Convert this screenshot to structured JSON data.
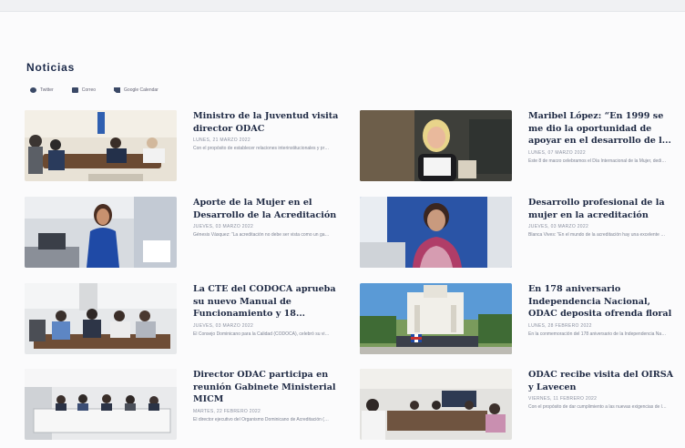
{
  "section": {
    "title": "Noticias"
  },
  "share": [
    {
      "label": "Twitter",
      "icon": "twitter-icon"
    },
    {
      "label": "Correo",
      "icon": "mail-icon"
    },
    {
      "label": "Google Calendar",
      "icon": "calendar-icon"
    }
  ],
  "news": [
    {
      "title": "Ministro de la Juventud visita director ODAC",
      "date": "LUNES, 21 MARZO 2022",
      "excerpt": "Con el propósito de establecer relaciones interinstitucionales y promover sinergias..."
    },
    {
      "title": "Maribel López: “En 1999 se me dio la oportunidad de apoyar en el desarrollo de l...",
      "date": "LUNES, 07 MARZO 2022",
      "excerpt": "Este 8 de marzo celebramos el Día Internacional de la Mujer, dedicado por la..."
    },
    {
      "title": "Aporte de la Mujer en el Desarrollo de la Acreditación",
      "date": "JUEVES, 03 MARZO 2022",
      "excerpt": "Génesis Vásquez: “La acreditación no debe ser vista como un gasto, sino como una..."
    },
    {
      "title": "Desarrollo profesional de la mujer en la acreditación",
      "date": "JUEVES, 03 MARZO 2022",
      "excerpt": "Blanca Vives: “En el mundo de la acreditación hay una excelente oportunidad para ei..."
    },
    {
      "title": "La CTE del CODOCA aprueba su nuevo Manual de Funcionamiento y 18...",
      "date": "JUEVES, 03 MARZO 2022",
      "excerpt": "El Consejo Dominicano para la Calidad (CODOCA), celebró su vigesimosexta reunió..."
    },
    {
      "title": "En 178 aniversario Independencia Nacional, ODAC deposita ofrenda floral",
      "date": "LUNES, 28 FEBRERO 2022",
      "excerpt": "En la conmemoración del 178 aniversario de la Independencia Nacional, el Organismo..."
    },
    {
      "title": "Director ODAC participa en reunión Gabinete Ministerial MICM",
      "date": "MARTES, 22 FEBRERO 2022",
      "excerpt": "El director ejecutivo del Organismo Dominicano de Acreditación (ODAC), Arqui..."
    },
    {
      "title": "ODAC recibe visita del OIRSA y Lavecen",
      "date": "VIERNES, 11 FEBRERO 2022",
      "excerpt": "Con el propósito de dar cumplimiento a las nuevas exigencias de la Unión Europea s..."
    }
  ]
}
